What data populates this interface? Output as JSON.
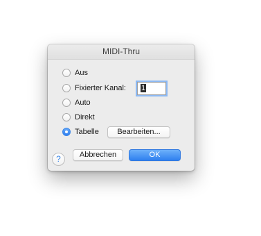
{
  "dialog": {
    "title": "MIDI-Thru",
    "options": [
      {
        "label": "Aus",
        "selected": false
      },
      {
        "label": "Fixierter Kanal:",
        "selected": false
      },
      {
        "label": "Auto",
        "selected": false
      },
      {
        "label": "Direkt",
        "selected": false
      },
      {
        "label": "Tabelle",
        "selected": true
      }
    ],
    "channel_value": "1",
    "edit_button": "Bearbeiten...",
    "cancel_button": "Abbrechen",
    "ok_button": "OK",
    "help_glyph": "?",
    "help_icon": "question-mark-icon",
    "accent_color": "#2f80ef"
  }
}
